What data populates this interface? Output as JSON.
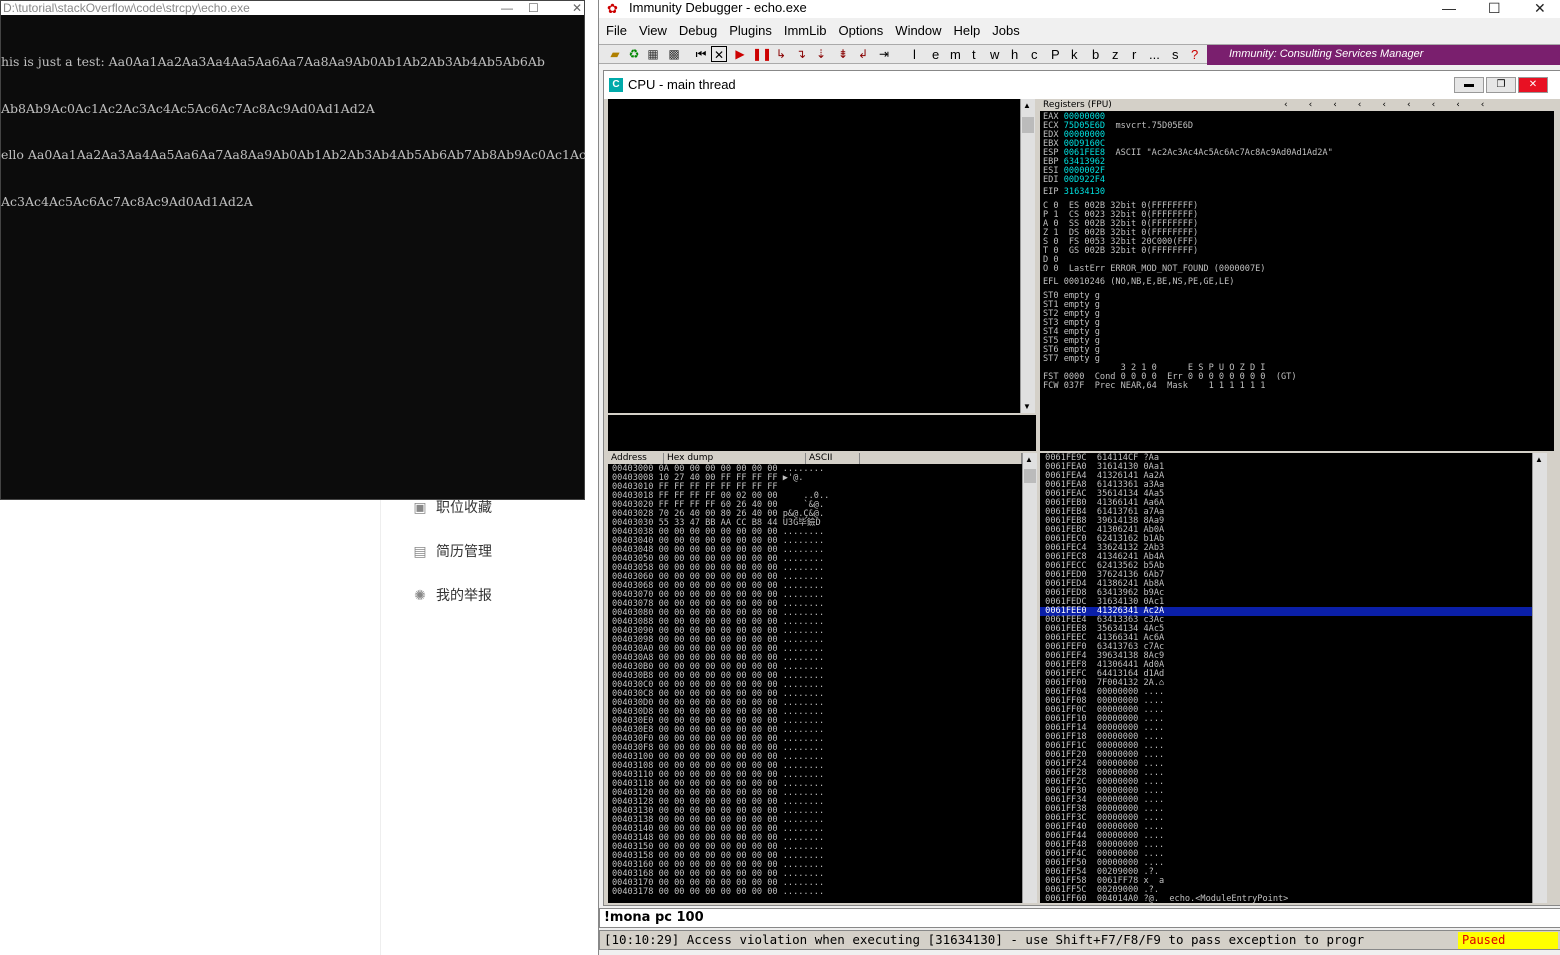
{
  "background_page": {
    "items": [
      {
        "icon": "star-folder-icon",
        "label": "职位收藏"
      },
      {
        "icon": "document-icon",
        "label": "简历管理"
      },
      {
        "icon": "megaphone-icon",
        "label": "我的举报"
      }
    ]
  },
  "console": {
    "title": "D:\\tutorial\\stackOverflow\\code\\strcpy\\echo.exe",
    "lines": [
      "his is just a test: Aa0Aa1Aa2Aa3Aa4Aa5Aa6Aa7Aa8Aa9Ab0Ab1Ab2Ab3Ab4Ab5Ab6Ab",
      "Ab8Ab9Ac0Ac1Ac2Ac3Ac4Ac5Ac6Ac7Ac8Ac9Ad0Ad1Ad2A",
      "ello Aa0Aa1Aa2Aa3Aa4Aa5Aa6Aa7Aa8Aa9Ab0Ab1Ab2Ab3Ab4Ab5Ab6Ab7Ab8Ab9Ac0Ac1Ac",
      "Ac3Ac4Ac5Ac6Ac7Ac8Ac9Ad0Ad1Ad2A"
    ]
  },
  "debugger": {
    "title": "Immunity Debugger - echo.exe",
    "menu": [
      "File",
      "View",
      "Debug",
      "Plugins",
      "ImmLib",
      "Options",
      "Window",
      "Help",
      "Jobs"
    ],
    "toolbar_letters": [
      "l",
      "e",
      "m",
      "t",
      "w",
      "h",
      "c",
      "P",
      "k",
      "b",
      "z",
      "r",
      "...",
      "s",
      "?"
    ],
    "banner": "Immunity: Consulting Services Manager",
    "cpu_title": "CPU - main thread",
    "registers_header": "Registers (FPU)",
    "registers": [
      [
        "EAX",
        "00000000",
        ""
      ],
      [
        "ECX",
        "75D05E6D",
        "msvcrt.75D05E6D"
      ],
      [
        "EDX",
        "00000000",
        ""
      ],
      [
        "EBX",
        "00D9160C",
        ""
      ],
      [
        "ESP",
        "0061FEE8",
        "ASCII \"Ac2Ac3Ac4Ac5Ac6Ac7Ac8Ac9Ad0Ad1Ad2A\""
      ],
      [
        "EBP",
        "63413962",
        ""
      ],
      [
        "ESI",
        "0000002F",
        ""
      ],
      [
        "EDI",
        "00D922F4",
        ""
      ]
    ],
    "eip": [
      "EIP",
      "31634130"
    ],
    "flags": [
      "C 0  ES 002B 32bit 0(FFFFFFFF)",
      "P 1  CS 0023 32bit 0(FFFFFFFF)",
      "A 0  SS 002B 32bit 0(FFFFFFFF)",
      "Z 1  DS 002B 32bit 0(FFFFFFFF)",
      "S 0  FS 0053 32bit 20C000(FFF)",
      "T 0  GS 002B 32bit 0(FFFFFFFF)",
      "D 0",
      "O 0  LastErr ERROR_MOD_NOT_FOUND (0000007E)"
    ],
    "efl": "EFL 00010246 (NO,NB,E,BE,NS,PE,GE,LE)",
    "fpu": [
      "ST0 empty g",
      "ST1 empty g",
      "ST2 empty g",
      "ST3 empty g",
      "ST4 empty g",
      "ST5 empty g",
      "ST6 empty g",
      "ST7 empty g",
      "               3 2 1 0      E S P U O Z D I",
      "FST 0000  Cond 0 0 0 0  Err 0 0 0 0 0 0 0 0  (GT)",
      "FCW 037F  Prec NEAR,64  Mask    1 1 1 1 1 1"
    ],
    "dump_headers": [
      "Address",
      "Hex dump",
      "ASCII"
    ],
    "dump_rows": [
      "00403000 0A 00 00 00 00 00 00 00 ........",
      "00403008 10 27 40 00 FF FF FF FF ▶'@.    ",
      "00403010 FF FF FF FF FF FF FF FF         ",
      "00403018 FF FF FF FF 00 02 00 00     ..0..",
      "00403020 FF FF FF FF 60 26 40 00     `&@.",
      "00403028 70 26 40 00 80 26 40 00 p&@.Ç&@.",
      "00403030 55 33 47 BB AA CC B8 44 U3G毕鐱D",
      "00403038 00 00 00 00 00 00 00 00 ........",
      "00403040 00 00 00 00 00 00 00 00 ........",
      "00403048 00 00 00 00 00 00 00 00 ........",
      "00403050 00 00 00 00 00 00 00 00 ........",
      "00403058 00 00 00 00 00 00 00 00 ........",
      "00403060 00 00 00 00 00 00 00 00 ........",
      "00403068 00 00 00 00 00 00 00 00 ........",
      "00403070 00 00 00 00 00 00 00 00 ........",
      "00403078 00 00 00 00 00 00 00 00 ........",
      "00403080 00 00 00 00 00 00 00 00 ........",
      "00403088 00 00 00 00 00 00 00 00 ........",
      "00403090 00 00 00 00 00 00 00 00 ........",
      "00403098 00 00 00 00 00 00 00 00 ........",
      "004030A0 00 00 00 00 00 00 00 00 ........",
      "004030A8 00 00 00 00 00 00 00 00 ........",
      "004030B0 00 00 00 00 00 00 00 00 ........",
      "004030B8 00 00 00 00 00 00 00 00 ........",
      "004030C0 00 00 00 00 00 00 00 00 ........",
      "004030C8 00 00 00 00 00 00 00 00 ........",
      "004030D0 00 00 00 00 00 00 00 00 ........",
      "004030D8 00 00 00 00 00 00 00 00 ........",
      "004030E0 00 00 00 00 00 00 00 00 ........",
      "004030E8 00 00 00 00 00 00 00 00 ........",
      "004030F0 00 00 00 00 00 00 00 00 ........",
      "004030F8 00 00 00 00 00 00 00 00 ........",
      "00403100 00 00 00 00 00 00 00 00 ........",
      "00403108 00 00 00 00 00 00 00 00 ........",
      "00403110 00 00 00 00 00 00 00 00 ........",
      "00403118 00 00 00 00 00 00 00 00 ........",
      "00403120 00 00 00 00 00 00 00 00 ........",
      "00403128 00 00 00 00 00 00 00 00 ........",
      "00403130 00 00 00 00 00 00 00 00 ........",
      "00403138 00 00 00 00 00 00 00 00 ........",
      "00403140 00 00 00 00 00 00 00 00 ........",
      "00403148 00 00 00 00 00 00 00 00 ........",
      "00403150 00 00 00 00 00 00 00 00 ........",
      "00403158 00 00 00 00 00 00 00 00 ........",
      "00403160 00 00 00 00 00 00 00 00 ........",
      "00403168 00 00 00 00 00 00 00 00 ........",
      "00403170 00 00 00 00 00 00 00 00 ........",
      "00403178 00 00 00 00 00 00 00 00 ........"
    ],
    "stack_rows": [
      "0061FE9C  614114CF ?Aa",
      "0061FEA0  31614130 0Aa1",
      "0061FEA4  41326141 Aa2A",
      "0061FEA8  61413361 a3Aa",
      "0061FEAC  35614134 4Aa5",
      "0061FEB0  41366141 Aa6A",
      "0061FEB4  61413761 a7Aa",
      "0061FEB8  39614138 8Aa9",
      "0061FEBC  41306241 Ab0A",
      "0061FEC0  62413162 b1Ab",
      "0061FEC4  33624132 2Ab3",
      "0061FEC8  41346241 Ab4A",
      "0061FECC  62413562 b5Ab",
      "0061FED0  37624136 6Ab7",
      "0061FED4  41386241 Ab8A",
      "0061FED8  63413962 b9Ac",
      "0061FEDC  31634130 0Ac1",
      "0061FEE0  41326341 Ac2A",
      "0061FEE4  63413363 c3Ac",
      "0061FEE8  35634134 4Ac5",
      "0061FEEC  41366341 Ac6A",
      "0061FEF0  63413763 c7Ac",
      "0061FEF4  39634138 8Ac9",
      "0061FEF8  41306441 Ad0A",
      "0061FEFC  64413164 d1Ad",
      "0061FF00  7F004132 2A.⌂",
      "0061FF04  00000000 ....",
      "0061FF08  00000000 ....",
      "0061FF0C  00000000 ....",
      "0061FF10  00000000 ....",
      "0061FF14  00000000 ....",
      "0061FF18  00000000 ....",
      "0061FF1C  00000000 ....",
      "0061FF20  00000000 ....",
      "0061FF24  00000000 ....",
      "0061FF28  00000000 ....",
      "0061FF2C  00000000 ....",
      "0061FF30  00000000 ....",
      "0061FF34  00000000 ....",
      "0061FF38  00000000 ....",
      "0061FF3C  00000000 ....",
      "0061FF40  00000000 ....",
      "0061FF44  00000000 ....",
      "0061FF48  00000000 ....",
      "0061FF4C  00000000 ....",
      "0061FF50  00000000 ....",
      "0061FF54  00209000 .?.",
      "0061FF58  0061FF78 x  a",
      "0061FF5C  00209000 .?.",
      "0061FF60  004014A0 ?@.  echo.<ModuleEntryPoint>"
    ],
    "stack_highlight_index": 17,
    "command": "!mona pc 100",
    "status_message": "[10:10:29] Access violation when executing [31634130] - use Shift+F7/F8/F9 to pass exception to progr",
    "status_state": "Paused"
  }
}
